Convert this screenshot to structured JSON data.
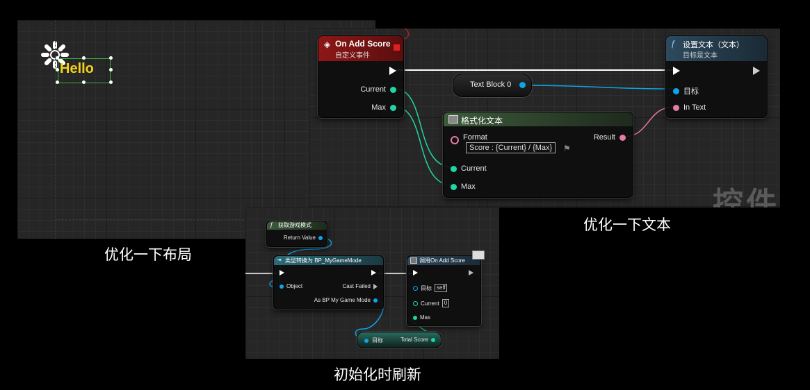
{
  "captions": {
    "layout": "优化一下布局",
    "text": "优化一下文本",
    "init": "初始化时刷新"
  },
  "widget": {
    "hello_text": "Hello",
    "text_color": "#f5d21a"
  },
  "text_panel": {
    "on_add_score": {
      "title": "On Add Score",
      "subtitle": "自定义事件",
      "current": "Current",
      "max": "Max"
    },
    "text_block": {
      "label": "Text Block 0"
    },
    "set_text": {
      "title": "设置文本（文本）",
      "subtitle": "目标是文本",
      "target": "目标",
      "in_text": "In Text"
    },
    "format_text": {
      "title": "格式化文本",
      "format_label": "Format",
      "format_value": "Score : {Current} / {Max}",
      "result": "Result",
      "current": "Current",
      "max": "Max"
    },
    "watermark": "控件"
  },
  "init_panel": {
    "get_game_mode": {
      "title": "获取游戏模式",
      "return_value": "Return Value"
    },
    "cast": {
      "title": "类型转换为 BP_MyGameMode",
      "object": "Object",
      "cast_failed": "Cast Failed",
      "as_bp": "As BP My Game Mode"
    },
    "call": {
      "title": "调用On Add Score",
      "target": "目标",
      "target_value": "self",
      "current": "Current",
      "current_value": "0",
      "max": "Max"
    },
    "total_score": {
      "target": "目标",
      "total": "Total Score"
    }
  },
  "colors": {
    "exec": "#ffffff",
    "int_pin": "#1fd6a4",
    "object_pin": "#0ea4ea",
    "text_pin": "#e87aa8",
    "event_header": "#8e1717",
    "function_header": "#2d4a5e",
    "pure_header": "#3d5a3a",
    "cast_header": "#2a6b78"
  }
}
